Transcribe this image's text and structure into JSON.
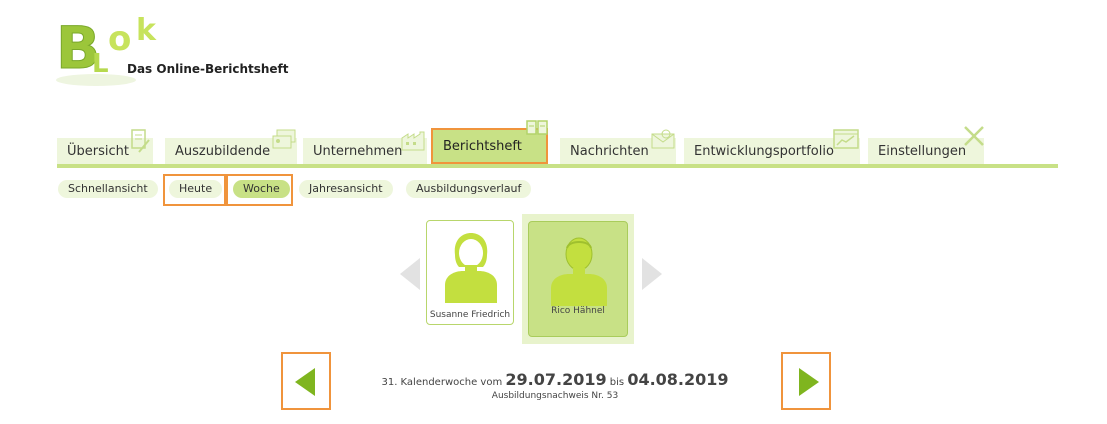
{
  "logo": {
    "brand": "BLoK",
    "tagline": "Das Online-Berichtsheft"
  },
  "tabs": [
    {
      "label": "Übersicht",
      "icon": "document-pen-icon"
    },
    {
      "label": "Auszubildende",
      "icon": "id-cards-icon"
    },
    {
      "label": "Unternehmen",
      "icon": "factory-icon"
    },
    {
      "label": "Berichtsheft",
      "icon": "open-book-icon",
      "active": true
    },
    {
      "label": "Nachrichten",
      "icon": "envelope-icon"
    },
    {
      "label": "Entwicklungsportfolio",
      "icon": "chart-window-icon"
    },
    {
      "label": "Einstellungen",
      "icon": "tools-icon"
    }
  ],
  "subtabs": [
    {
      "label": "Schnellansicht"
    },
    {
      "label": "Heute"
    },
    {
      "label": "Woche",
      "active": true
    },
    {
      "label": "Jahresansicht"
    },
    {
      "label": "Ausbildungsverlauf"
    }
  ],
  "people": [
    {
      "name": "Susanne Friedrich",
      "gender": "female",
      "selected": false
    },
    {
      "name": "Rico Hähnel",
      "gender": "male",
      "selected": true
    }
  ],
  "week": {
    "kw_text": "31. Kalenderwoche vom",
    "from": "29.07.2019",
    "bis": "bis",
    "to": "04.08.2019",
    "nachweis": "Ausbildungsnachweis Nr. 53"
  },
  "colors": {
    "accent": "#c8e186",
    "highlight": "#f0943c",
    "arrow": "#7fb51f"
  }
}
